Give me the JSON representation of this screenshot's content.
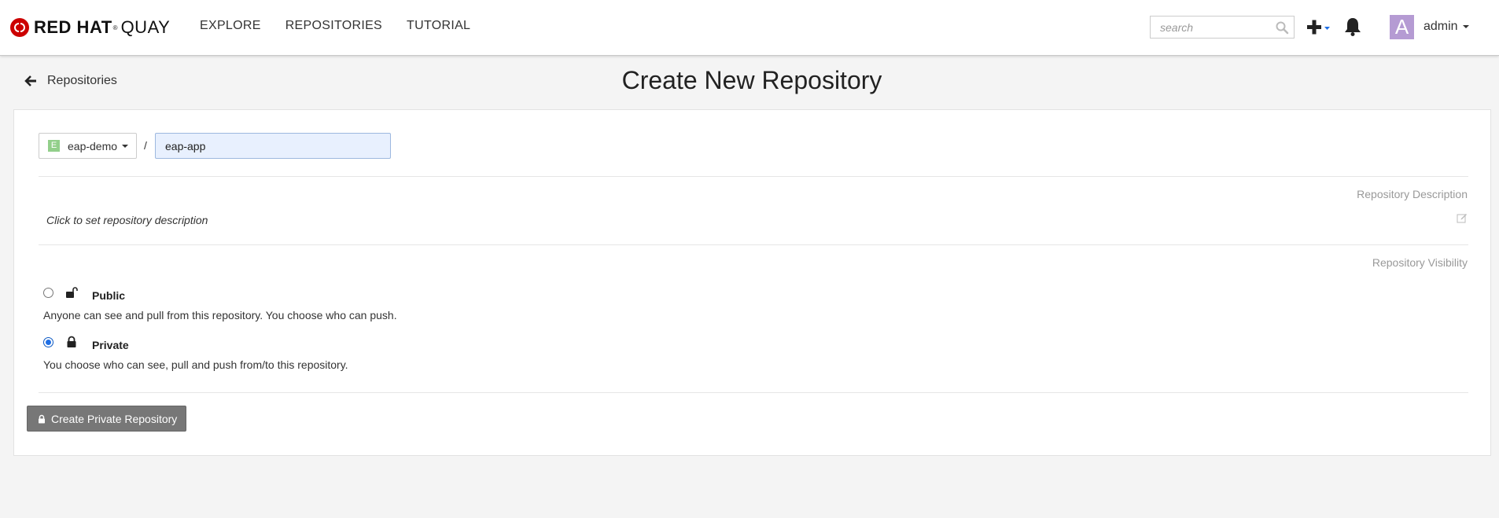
{
  "brand": {
    "name_bold": "RED HAT",
    "registered": "®",
    "name_light": "QUAY",
    "brand_color": "#cc0000"
  },
  "nav": {
    "links": [
      {
        "label": "EXPLORE"
      },
      {
        "label": "REPOSITORIES"
      },
      {
        "label": "TUTORIAL"
      }
    ],
    "search_placeholder": "search",
    "plus_icon": "plus-icon",
    "bell_icon": "bell-icon"
  },
  "user": {
    "avatar_letter": "A",
    "username": "admin",
    "avatar_color": "#b59bd3"
  },
  "header": {
    "back_label": "Repositories",
    "title": "Create New Repository"
  },
  "form": {
    "namespace": {
      "avatar_letter": "E",
      "name": "eap-demo",
      "avatar_color": "#92cf8a"
    },
    "separator": "/",
    "repo_name_value": "eap-app",
    "description_label": "Repository Description",
    "description_placeholder": "Click to set repository description",
    "visibility_label": "Repository Visibility",
    "visibility_options": [
      {
        "title": "Public",
        "description": "Anyone can see and pull from this repository. You choose who can push.",
        "selected": false,
        "icon": "unlock-icon"
      },
      {
        "title": "Private",
        "description": "You choose who can see, pull and push from/to this repository.",
        "selected": true,
        "icon": "lock-icon"
      }
    ],
    "submit_label": "Create Private Repository"
  },
  "colors": {
    "accent_blue": "#1f6fe5",
    "submit_button": "#777777"
  }
}
